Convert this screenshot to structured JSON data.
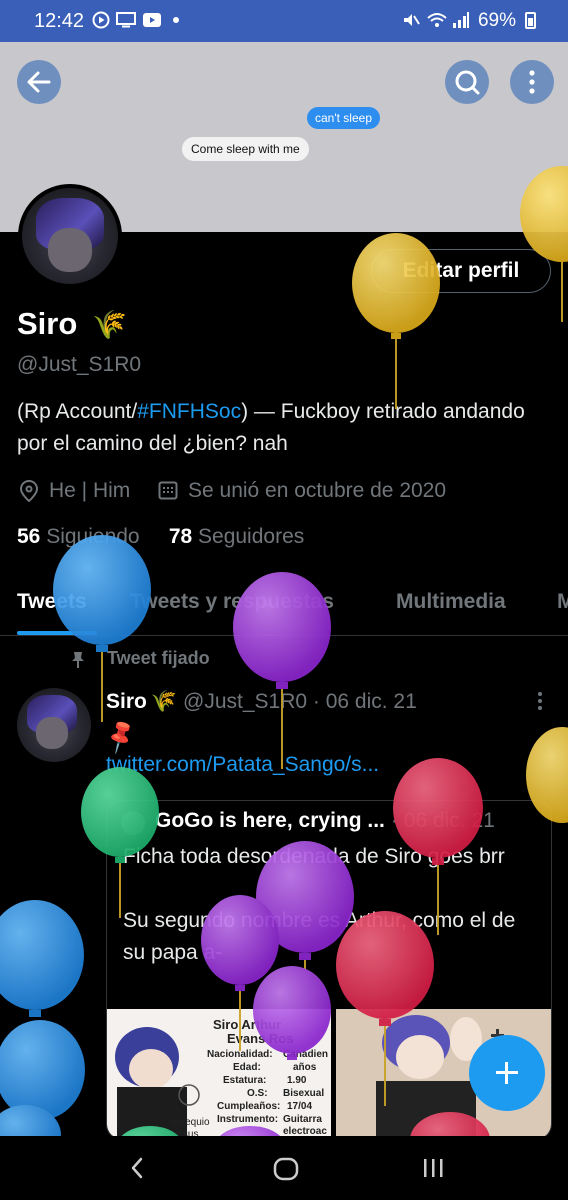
{
  "status_bar": {
    "time": "12:42",
    "battery": "69%"
  },
  "banner": {
    "bubble_right": "can't sleep",
    "bubble_left": "Come sleep with me"
  },
  "profile": {
    "edit_button": "Editar perfil",
    "name": "Siro",
    "name_emoji": "🌾",
    "handle": "@Just_S1R0",
    "bio_before": "(Rp Account/",
    "bio_link": "#FNFHSoc",
    "bio_after": ") — Fuckboy retirado andando por el camino del ¿bien? nah",
    "location": "He | Him",
    "joined": "Se unió en octubre de 2020",
    "following_count": "56",
    "following_label": "Siguiendo",
    "followers_count": "78",
    "followers_label": "Seguidores"
  },
  "tabs": [
    {
      "label": "Tweets"
    },
    {
      "label": "Tweets y respuestas"
    },
    {
      "label": "Multimedia"
    },
    {
      "label": "M"
    }
  ],
  "tweet": {
    "pinned_label": "Tweet fijado",
    "author_name": "Siro",
    "author_emoji": "🌾",
    "author_meta": "@Just_S1R0 · 06 dic. 21",
    "pin_emoji": "📌",
    "link": "twitter.com/Patata_Sango/s...",
    "quote": {
      "author_name": "GoGo is here, crying ...",
      "meta": "06 dic. 21",
      "text": "Ficha toda desordenada de Siro goes brr\n\nSu segundo nombre es Arthur, como el de su papa a-"
    },
    "image1": {
      "title": "Siro Arthur",
      "title2": "Evans Ros",
      "labels": [
        "Nacionalidad:",
        "Edad:",
        "Estatura:",
        "O.S:",
        "Cumpleaños:",
        "Instrumento:"
      ],
      "values": [
        "Canadien",
        "años",
        "1.90",
        "Bisexual",
        "17/04",
        "Guitarra electroac"
      ],
      "caption": "obsequio de sus padres"
    }
  },
  "colors": {
    "accent": "#1d9bf0",
    "status_bar": "#3a5fb8",
    "banner": "#c8c8cc",
    "balloon_yellow": "#e8c02a",
    "balloon_blue": "#2a8fe0",
    "balloon_purple": "#9a35d6",
    "balloon_red": "#e0304f",
    "balloon_green": "#2bc07a"
  },
  "icons": [
    "back-arrow-icon",
    "search-icon",
    "kebab-menu-icon",
    "location-pin-icon",
    "calendar-icon",
    "pin-icon",
    "plus-icon",
    "nav-back-icon",
    "nav-home-icon",
    "nav-recents-icon"
  ]
}
